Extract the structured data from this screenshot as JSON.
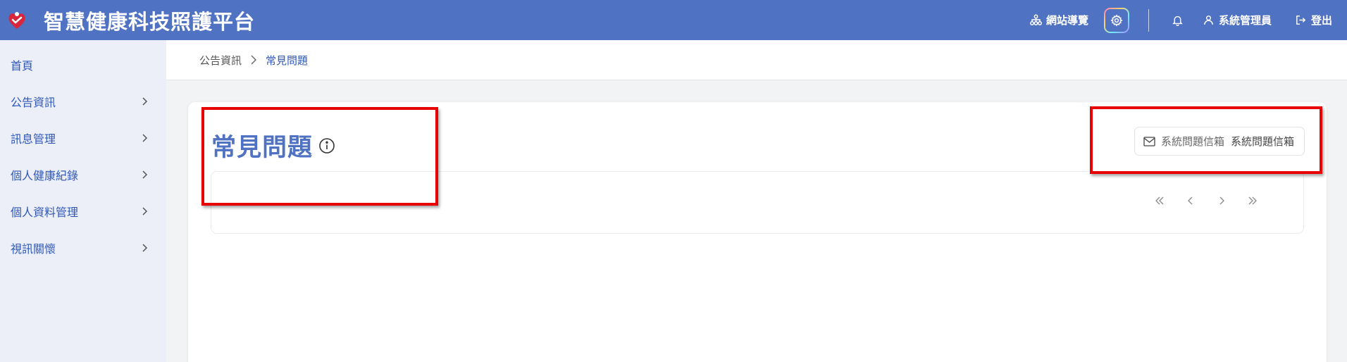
{
  "header": {
    "app_title": "智慧健康科技照護平台",
    "sitemap_label": "網站導覽",
    "user_label": "系統管理員",
    "logout_label": "登出"
  },
  "sidebar": {
    "items": [
      {
        "label": "首頁",
        "has_chevron": false
      },
      {
        "label": "公告資訊",
        "has_chevron": true
      },
      {
        "label": "訊息管理",
        "has_chevron": true
      },
      {
        "label": "個人健康紀錄",
        "has_chevron": true
      },
      {
        "label": "個人資料管理",
        "has_chevron": true
      },
      {
        "label": "視訊關懷",
        "has_chevron": true
      }
    ]
  },
  "breadcrumb": {
    "parent": "公告資訊",
    "current": "常見問題"
  },
  "main": {
    "page_title": "常見問題",
    "mail_button_label": "系統問題信箱",
    "mail_button_label_2": "系統問題信箱"
  },
  "icons": {
    "logo": "heart-care-logo-icon",
    "sitemap": "sitemap-icon",
    "settings": "gear-icon",
    "notifications": "bell-icon",
    "user": "user-icon",
    "logout": "logout-icon",
    "info": "info-icon",
    "mail": "mail-icon",
    "pager": [
      "first-page-icon",
      "prev-page-icon",
      "next-page-icon",
      "last-page-icon"
    ]
  },
  "colors": {
    "brand": "#5072c2",
    "nav_text": "#2f58b6",
    "sidebar_bg": "#eceef8",
    "highlight": "#e80000"
  }
}
